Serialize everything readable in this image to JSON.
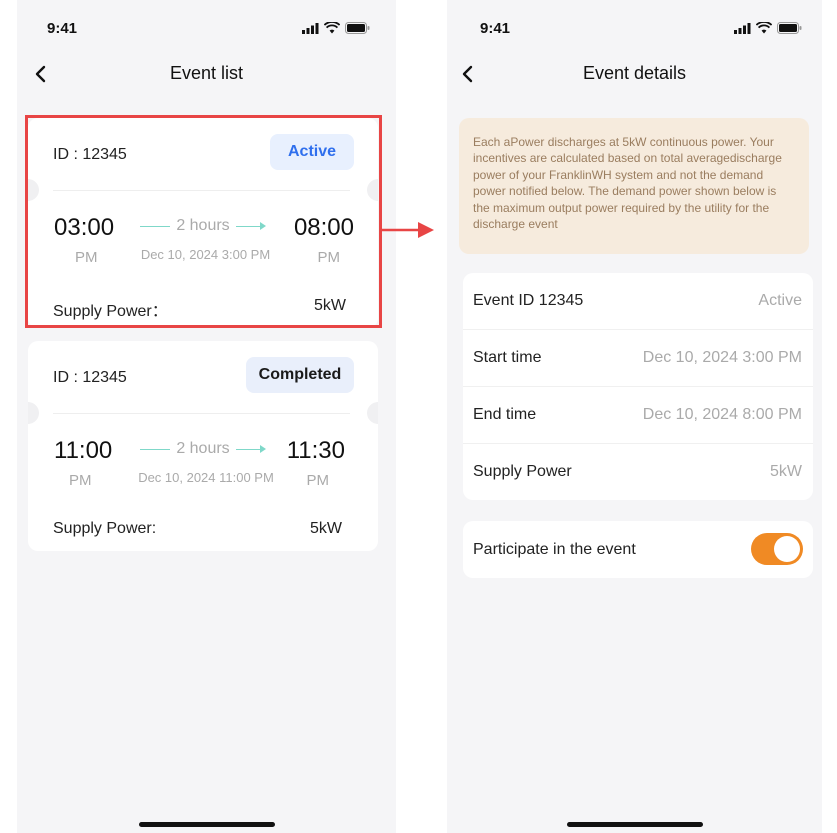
{
  "status_bar": {
    "time": "9:41"
  },
  "event_list": {
    "title": "Event list",
    "events": [
      {
        "id": "ID : 12345",
        "status": "Active",
        "start_time": "03:00",
        "start_ampm": "PM",
        "end_time": "08:00",
        "end_ampm": "PM",
        "duration": "2 hours",
        "date": "Dec 10, 2024 3:00 PM",
        "supply_label": "Supply Power：",
        "supply_value": "5kW"
      },
      {
        "id": "ID : 12345",
        "status": "Completed",
        "start_time": "11:00",
        "start_ampm": "PM",
        "end_time": "11:30",
        "end_ampm": "PM",
        "duration": "2 hours",
        "date": "Dec 10, 2024 11:00 PM",
        "supply_label": "Supply Power:",
        "supply_value": "5kW"
      }
    ]
  },
  "event_details": {
    "title": "Event details",
    "notice": "Each aPower discharges at 5kW continuous power. Your incentives are calculated based on total averagedischarge power of your FranklinWH system and not the demand power notified below. The demand power shown below is the maximum output power required by the utility for the discharge event",
    "rows": [
      {
        "label": "Event ID 12345",
        "value": "Active"
      },
      {
        "label": "Start time",
        "value": "Dec 10, 2024 3:00 PM"
      },
      {
        "label": "End time",
        "value": "Dec 10, 2024 8:00 PM"
      },
      {
        "label": "Supply Power",
        "value": "5kW"
      }
    ],
    "participate_label": "Participate in the event",
    "participate_on": true
  },
  "colors": {
    "accent_orange": "#f08a24",
    "active_blue": "#2f6fed",
    "highlight_red": "#e84545",
    "timeline_teal": "#7fd8c9"
  }
}
